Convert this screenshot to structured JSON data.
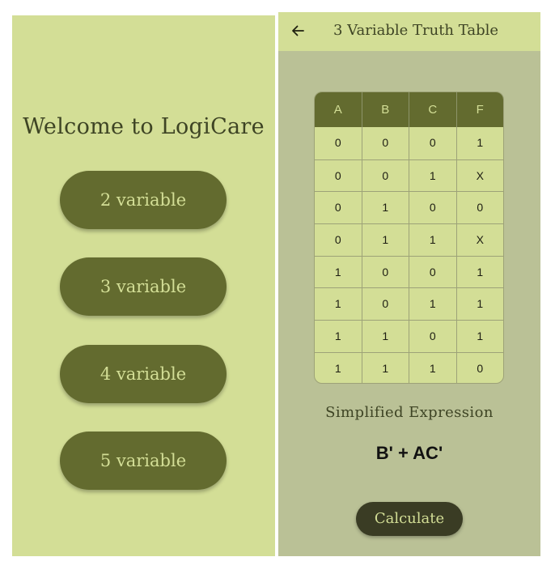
{
  "home": {
    "welcome": "Welcome to LogiCare",
    "buttons": [
      "2 variable",
      "3 variable",
      "4 variable",
      "5 variable"
    ]
  },
  "truth_table_screen": {
    "title": "3 Variable Truth Table",
    "back_icon": "arrow-left-icon",
    "headers": [
      "A",
      "B",
      "C",
      "F"
    ],
    "rows": [
      [
        "0",
        "0",
        "0",
        "1"
      ],
      [
        "0",
        "0",
        "1",
        "X"
      ],
      [
        "0",
        "1",
        "0",
        "0"
      ],
      [
        "0",
        "1",
        "1",
        "X"
      ],
      [
        "1",
        "0",
        "0",
        "1"
      ],
      [
        "1",
        "0",
        "1",
        "1"
      ],
      [
        "1",
        "1",
        "0",
        "1"
      ],
      [
        "1",
        "1",
        "1",
        "0"
      ]
    ],
    "simplified_label": "Simplified Expression",
    "expression": "B' + AC'",
    "calculate_label": "Calculate"
  },
  "colors": {
    "light_green": "#d3de96",
    "olive": "#636b2f",
    "sage_background": "#bac196",
    "dark_button": "#3a3c24"
  }
}
